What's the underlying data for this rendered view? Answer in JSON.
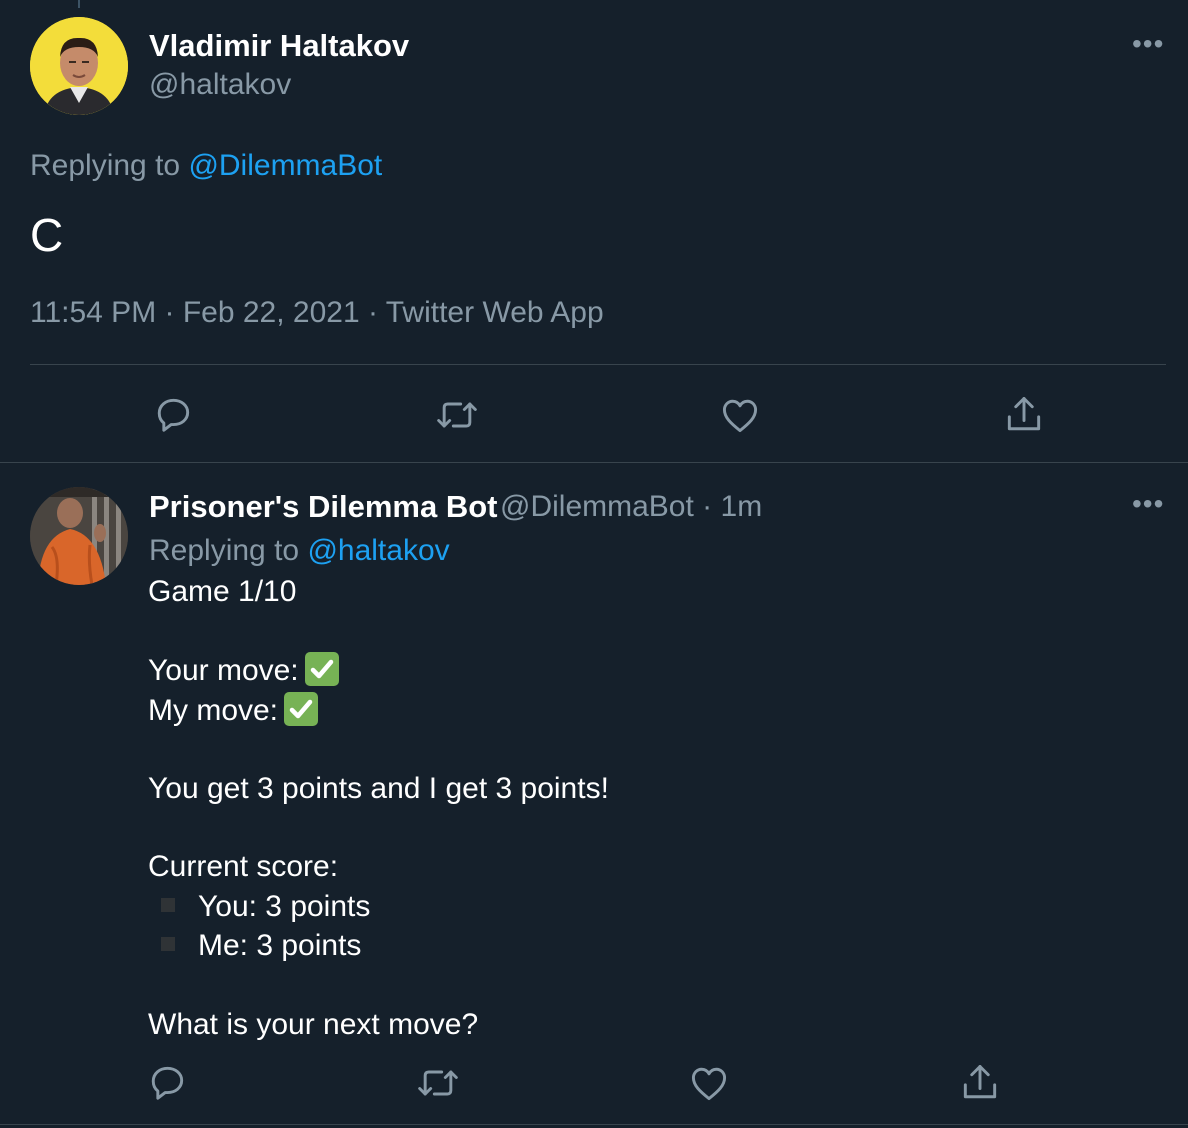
{
  "main_tweet": {
    "author_name": "Vladimir Haltakov",
    "author_handle": "@haltakov",
    "replying_prefix": "Replying to",
    "replying_mention": "@DilemmaBot",
    "text": "C",
    "meta": "11:54 PM · Feb 22, 2021 · Twitter Web App",
    "more_glyph": "•••"
  },
  "reply_tweet": {
    "author_name": "Prisoner's Dilemma Bot",
    "author_handle": "@DilemmaBot",
    "separator": "·",
    "time": "1m",
    "replying_prefix": "Replying to",
    "replying_mention": "@haltakov",
    "game": "Game 1/10",
    "your_move_label": "Your move:",
    "my_move_label": "My move:",
    "result": "You get 3 points and I get 3 points!",
    "score_heading": "Current score:",
    "score_you": "You: 3 points",
    "score_me": "Me: 3 points",
    "question": "What is your next move?",
    "more_glyph": "•••"
  },
  "icons": {
    "reply": "reply-icon",
    "retweet": "retweet-icon",
    "like": "heart-icon",
    "share": "share-icon",
    "move_check": "check-mark-button-icon"
  },
  "colors": {
    "background": "#15202b",
    "secondary_text": "#8899a6",
    "link": "#1da1f2",
    "divider": "#38444d",
    "check": "#77b255"
  }
}
